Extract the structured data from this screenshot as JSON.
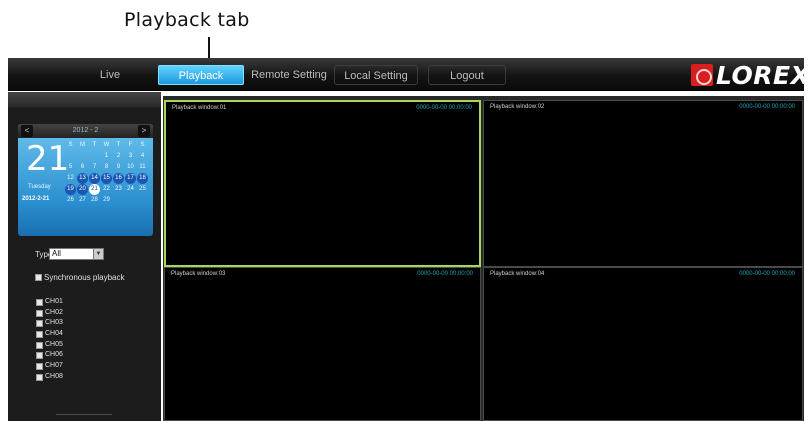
{
  "annotation": {
    "callout": "Playback tab"
  },
  "nav": {
    "tabs": [
      {
        "label": "Live"
      },
      {
        "label": "Playback"
      },
      {
        "label": "Remote Setting"
      },
      {
        "label": "Local Setting"
      },
      {
        "label": "Logout"
      }
    ],
    "active_tab": "Playback",
    "logo": "LOREX",
    "logo_mark": "®"
  },
  "calendar": {
    "month_label": "2012 - 2",
    "prev": "<",
    "next": ">",
    "big_day": "21",
    "weekday": "Tuesday",
    "date": "2012-2-21",
    "weekday_headers": [
      "S",
      "M",
      "T",
      "W",
      "T",
      "F",
      "S"
    ],
    "days": [
      "",
      "",
      "",
      "1",
      "2",
      "3",
      "4",
      "5",
      "6",
      "7",
      "8",
      "9",
      "10",
      "11",
      "12",
      "13",
      "14",
      "15",
      "16",
      "17",
      "18",
      "19",
      "20",
      "21",
      "22",
      "23",
      "24",
      "25",
      "26",
      "27",
      "28",
      "29",
      "",
      "",
      ""
    ]
  },
  "filters": {
    "type_label": "Type",
    "type_value": "All",
    "sync_label": "Synchronous playback",
    "channels": [
      "CH01",
      "CH02",
      "CH03",
      "CH04",
      "CH05",
      "CH06",
      "CH07",
      "CH08"
    ]
  },
  "windows": [
    {
      "title": "Playback window:01",
      "time": "0000-00-00 00:00:00"
    },
    {
      "title": "Playback window:02",
      "time": "0000-00-00 00:00:00"
    },
    {
      "title": "Playback window:03",
      "time": "0000-00-00 00:00:00"
    },
    {
      "title": "Playback window:04",
      "time": "0000-00-00 00:00:00"
    }
  ],
  "colors": {
    "active_tab": "#1e98dd",
    "selected_window_border": "#a4d65e",
    "timestamp": "#18a9b8",
    "logo_red": "#d81e1e"
  }
}
